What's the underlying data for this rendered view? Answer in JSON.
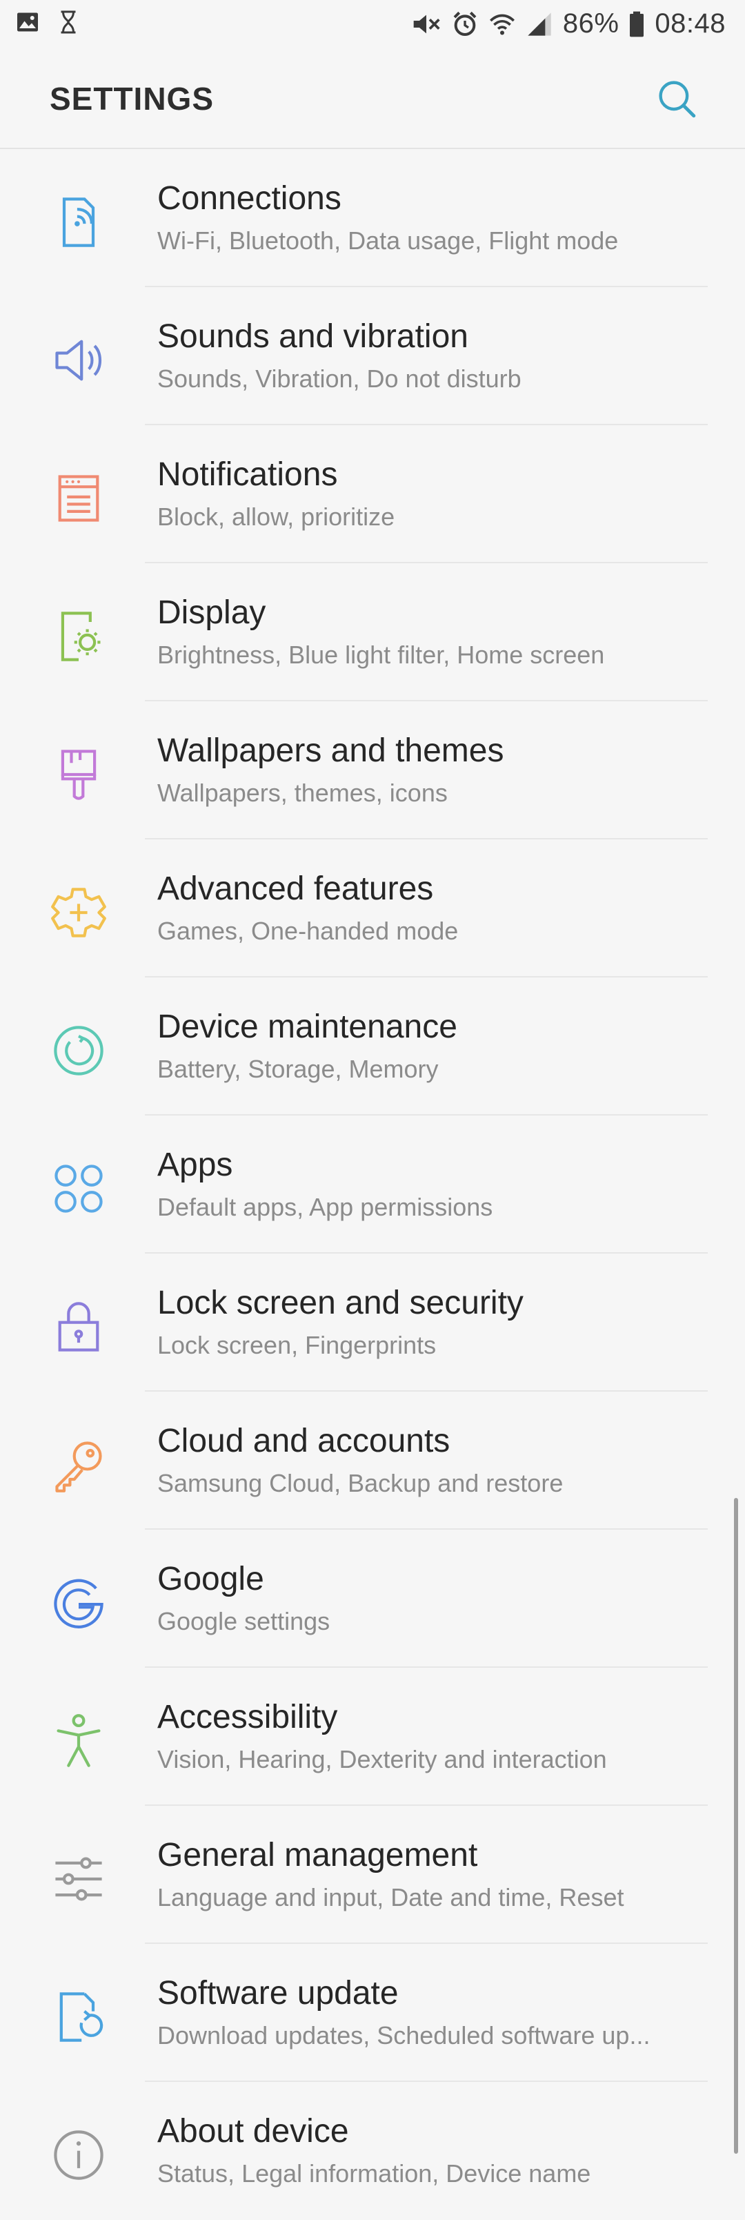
{
  "status_bar": {
    "battery_percent": "86%",
    "time": "08:48"
  },
  "header": {
    "title": "SETTINGS"
  },
  "colors": {
    "connections": "#4aa3df",
    "sounds": "#6f86d6",
    "notifications": "#f08a72",
    "display": "#8cc152",
    "wallpapers": "#c27ad8",
    "advanced": "#f2c14e",
    "maintenance": "#5cc9b4",
    "apps": "#5aa9e6",
    "lock": "#8b7ddb",
    "cloud": "#f39a5b",
    "google": "#4a7fe0",
    "accessibility": "#7cc26b",
    "general": "#9a9a9a",
    "software": "#4aa3df",
    "about": "#9a9a9a",
    "search": "#3aa3c4"
  },
  "items": [
    {
      "label": "Connections",
      "sub": "Wi-Fi, Bluetooth, Data usage, Flight mode",
      "icon": "connections-icon"
    },
    {
      "label": "Sounds and vibration",
      "sub": "Sounds, Vibration, Do not disturb",
      "icon": "speaker-icon"
    },
    {
      "label": "Notifications",
      "sub": "Block, allow, prioritize",
      "icon": "notifications-icon"
    },
    {
      "label": "Display",
      "sub": "Brightness, Blue light filter, Home screen",
      "icon": "display-icon"
    },
    {
      "label": "Wallpapers and themes",
      "sub": "Wallpapers, themes, icons",
      "icon": "brush-icon"
    },
    {
      "label": "Advanced features",
      "sub": "Games, One-handed mode",
      "icon": "gear-plus-icon"
    },
    {
      "label": "Device maintenance",
      "sub": "Battery, Storage, Memory",
      "icon": "maintenance-icon"
    },
    {
      "label": "Apps",
      "sub": "Default apps, App permissions",
      "icon": "apps-grid-icon"
    },
    {
      "label": "Lock screen and security",
      "sub": "Lock screen, Fingerprints",
      "icon": "lock-icon"
    },
    {
      "label": "Cloud and accounts",
      "sub": "Samsung Cloud, Backup and restore",
      "icon": "key-icon"
    },
    {
      "label": "Google",
      "sub": "Google settings",
      "icon": "google-icon"
    },
    {
      "label": "Accessibility",
      "sub": "Vision, Hearing, Dexterity and interaction",
      "icon": "accessibility-icon"
    },
    {
      "label": "General management",
      "sub": "Language and input, Date and time, Reset",
      "icon": "sliders-icon"
    },
    {
      "label": "Software update",
      "sub": "Download updates, Scheduled software up...",
      "icon": "software-update-icon"
    },
    {
      "label": "About device",
      "sub": "Status, Legal information, Device name",
      "icon": "info-icon"
    }
  ]
}
